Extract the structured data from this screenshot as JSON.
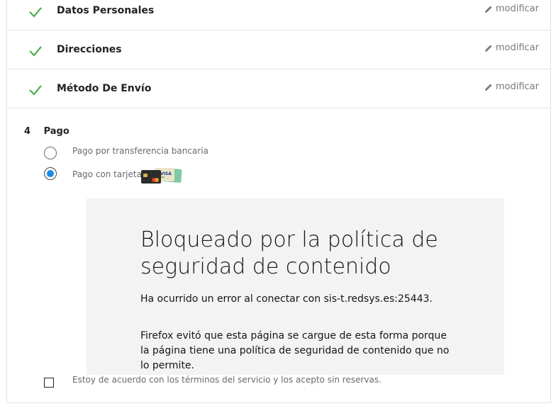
{
  "steps": [
    {
      "title": "Datos Personales",
      "edit": "modificar"
    },
    {
      "title": "Direcciones",
      "edit": "modificar"
    },
    {
      "title": "Método De Envío",
      "edit": "modificar"
    }
  ],
  "payment": {
    "number": "4",
    "title": "Pago",
    "options": [
      {
        "label": "Pago por transferencia bancaria",
        "selected": false
      },
      {
        "label": "Pago con tarjeta",
        "selected": true
      }
    ],
    "card_icons": [
      "mastercard",
      "visa"
    ]
  },
  "blocked_frame": {
    "heading": "Bloqueado por la política de seguridad de contenido",
    "error": "Ha ocurrido un error al conectar con sis-t.redsys.es:25443.",
    "explanation": "Firefox evitó que esta página se cargue de esta forma porque la página tiene una política de seguridad de contenido que no lo permite."
  },
  "terms": {
    "label": "Estoy de acuerdo con los términos del servicio y los acepto sin reservas.",
    "checked": false
  },
  "colors": {
    "check": "#4caf50",
    "radio_selected": "#1e8ae8",
    "panel_bg": "#f3f3f3"
  }
}
